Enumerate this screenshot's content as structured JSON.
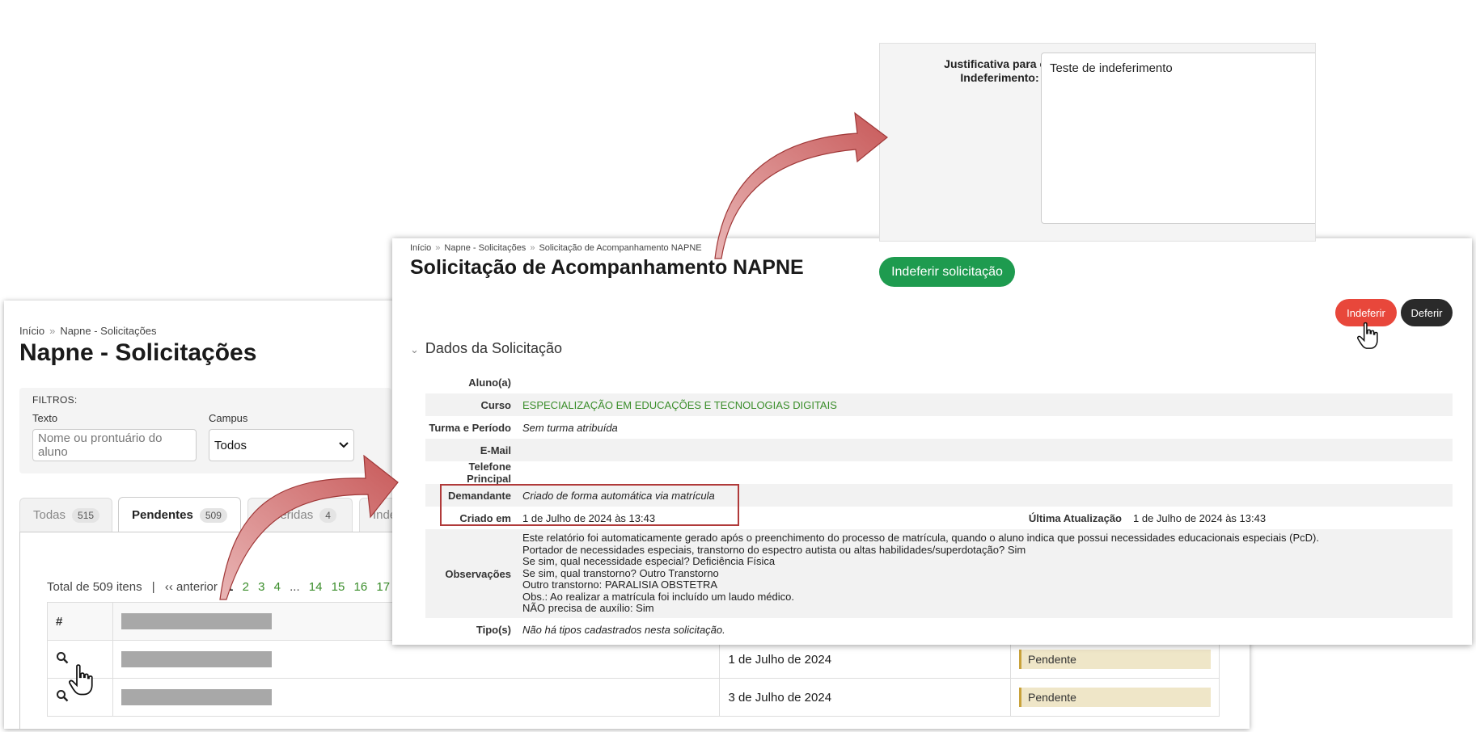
{
  "list_page": {
    "breadcrumb": [
      "Início",
      "Napne - Solicitações"
    ],
    "breadcrumb_sep": "»",
    "title": "Napne - Solicitações",
    "filters": {
      "heading": "FILTROS:",
      "text_label": "Texto",
      "text_placeholder": "Nome ou prontuário do aluno",
      "campus_label": "Campus",
      "campus_value": "Todos"
    },
    "tabs": [
      {
        "label": "Todas",
        "count": "515"
      },
      {
        "label": "Pendentes",
        "count": "509"
      },
      {
        "label": "Deferidas",
        "count": "4"
      },
      {
        "label": "Inde",
        "count": ""
      }
    ],
    "pagination": {
      "total": "Total de 509 itens",
      "sep": "|",
      "prev": "‹‹ anterior",
      "current": "1",
      "pages": [
        "2",
        "3",
        "4",
        "...",
        "14",
        "15",
        "16",
        "17"
      ]
    },
    "table": {
      "header": "#",
      "rows": [
        {
          "date": "1 de Julho de 2024",
          "status": "Pendente"
        },
        {
          "date": "3 de Julho de 2024",
          "status": "Pendente"
        }
      ]
    }
  },
  "detail_page": {
    "breadcrumb": [
      "Início",
      "Napne - Solicitações",
      "Solicitação de Acompanhamento NAPNE"
    ],
    "breadcrumb_sep": "»",
    "title": "Solicitação de Acompanhamento NAPNE",
    "actions": {
      "reject": "Indeferir",
      "approve": "Deferir"
    },
    "section": "Dados da Solicitação",
    "fields": {
      "aluno_label": "Aluno(a)",
      "aluno_value": "",
      "curso_label": "Curso",
      "curso_value": "ESPECIALIZAÇÃO EM EDUCAÇÕES E TECNOLOGIAS DIGITAIS",
      "turma_label": "Turma e Período",
      "turma_value": "Sem turma atribuída",
      "email_label": "E-Mail",
      "email_value": "",
      "telefone_label": "Telefone Principal",
      "telefone_value": "",
      "demandante_label": "Demandante",
      "demandante_value": "Criado de forma automática via matrícula",
      "criado_label": "Criado em",
      "criado_value": "1 de Julho de 2024 às 13:43",
      "atualizacao_label": "Última Atualização",
      "atualizacao_value": "1 de Julho de 2024 às 13:43",
      "obs_label": "Observações",
      "obs_lines": [
        "Este relatório foi automaticamente gerado após o preenchimento do processo de matrícula, quando o aluno indica que possui necessidades educacionais especiais (PcD).",
        "Portador de necessidades especiais, transtorno do espectro autista ou altas habilidades/superdotação? Sim",
        "Se sim, qual necessidade especial? Deficiência Física",
        "Se sim, qual transtorno? Outro Transtorno",
        "Outro transtorno: PARALISIA OBSTETRA",
        "Obs.: Ao realizar a matrícula foi incluído um laudo médico.",
        "NÃO precisa de auxílio: Sim"
      ],
      "tipos_label": "Tipo(s)",
      "tipos_value": "Não há tipos cadastrados nesta solicitação."
    }
  },
  "reject_form": {
    "label": "Justificativa para o Indeferimento:",
    "required_mark": "*",
    "value": "Teste de indeferimento",
    "submit": "Indeferir solicitação"
  },
  "colors": {
    "link_green": "#3a8d2a",
    "reject_red": "#e8473b",
    "approve_dark": "#2a2a2a",
    "submit_green": "#1e9b4f",
    "status_yellow": "#efe6c8",
    "highlight_red": "#b03a3a"
  },
  "icons": [
    "search-icon",
    "hand-pointer-icon",
    "chevron-down-icon",
    "annotation-arrow"
  ]
}
